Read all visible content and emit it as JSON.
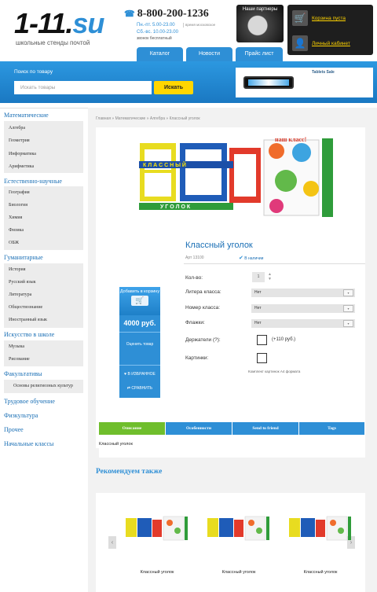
{
  "header": {
    "logo": "1-11.su",
    "logo_sub": "школьные стенды почтой",
    "phone": "8-800-200-1236",
    "hours_weekday": "Пн.-пт. 5.00-23.00",
    "hours_weekend": "Сб.-вс. 10.00-23.00",
    "hours_note": "время московское",
    "free_call": "звонок бесплатный",
    "partners": "Наши партнеры",
    "cart": "Корзина пуста",
    "account": "Личный кабинет",
    "nav": [
      "Каталог",
      "Новости",
      "Прайс лист"
    ]
  },
  "search": {
    "label": "Поиск по товару",
    "placeholder": "Искать товары",
    "button": "Искать",
    "banner_title": "Tablets Sale"
  },
  "sidebar": {
    "categories": [
      {
        "name": "Математические",
        "items": [
          "Алгебра",
          "Геометрия",
          "Информатика",
          "Арифметика"
        ]
      },
      {
        "name": "Естественно-научные",
        "items": [
          "География",
          "Биология",
          "Химия",
          "Физика",
          "ОБЖ"
        ]
      },
      {
        "name": "Гуманитарные",
        "items": [
          "История",
          "Русский язык",
          "Литература",
          "Обществознание",
          "Иностранный язык"
        ]
      },
      {
        "name": "Искусство в школе",
        "items": [
          "Музыка",
          "Рисование"
        ]
      },
      {
        "name": "Факультативы",
        "items": [
          "Основы религиозных культур"
        ]
      },
      {
        "name": "Трудовое обучение",
        "items": []
      },
      {
        "name": "Физкультура",
        "items": []
      },
      {
        "name": "Прочее",
        "items": []
      },
      {
        "name": "Начальные классы",
        "items": []
      }
    ]
  },
  "breadcrumb": "Главная » Математические » Алгебра » Классный уголок",
  "product": {
    "title": "Классный уголок",
    "sku": "Арт 13100",
    "availability": "В наличии",
    "qty_label": "Кол-во:",
    "qty": "1",
    "options": [
      {
        "label": "Литера класса:",
        "value": "Нет"
      },
      {
        "label": "Номер класса:",
        "value": "Нет"
      },
      {
        "label": "Флажки:",
        "value": "Нет"
      }
    ],
    "holders_label": "Держатели (?):",
    "holders_price": "(+110 руб.)",
    "pictures_label": "Картинки:",
    "set_note": "Комплект картинок А4 формата",
    "add_to_cart": "Добавить в корзину",
    "price": "4000 руб.",
    "rate": "Оценить товар",
    "favorites": "В ИЗБРАННОЕ",
    "compare": "СРАВНИТЬ"
  },
  "tabs": [
    "Описание",
    "Особенности",
    "Send to friend",
    "Tags"
  ],
  "description": "Классный уголок",
  "recommend": {
    "title": "Рекомендуем также",
    "items": [
      "Классный уголок",
      "Классный уголок",
      "Классный уголок"
    ]
  },
  "colors": {
    "accent": "#2e8fd6",
    "active_tab": "#6fbe2c",
    "button": "#ffd600"
  }
}
